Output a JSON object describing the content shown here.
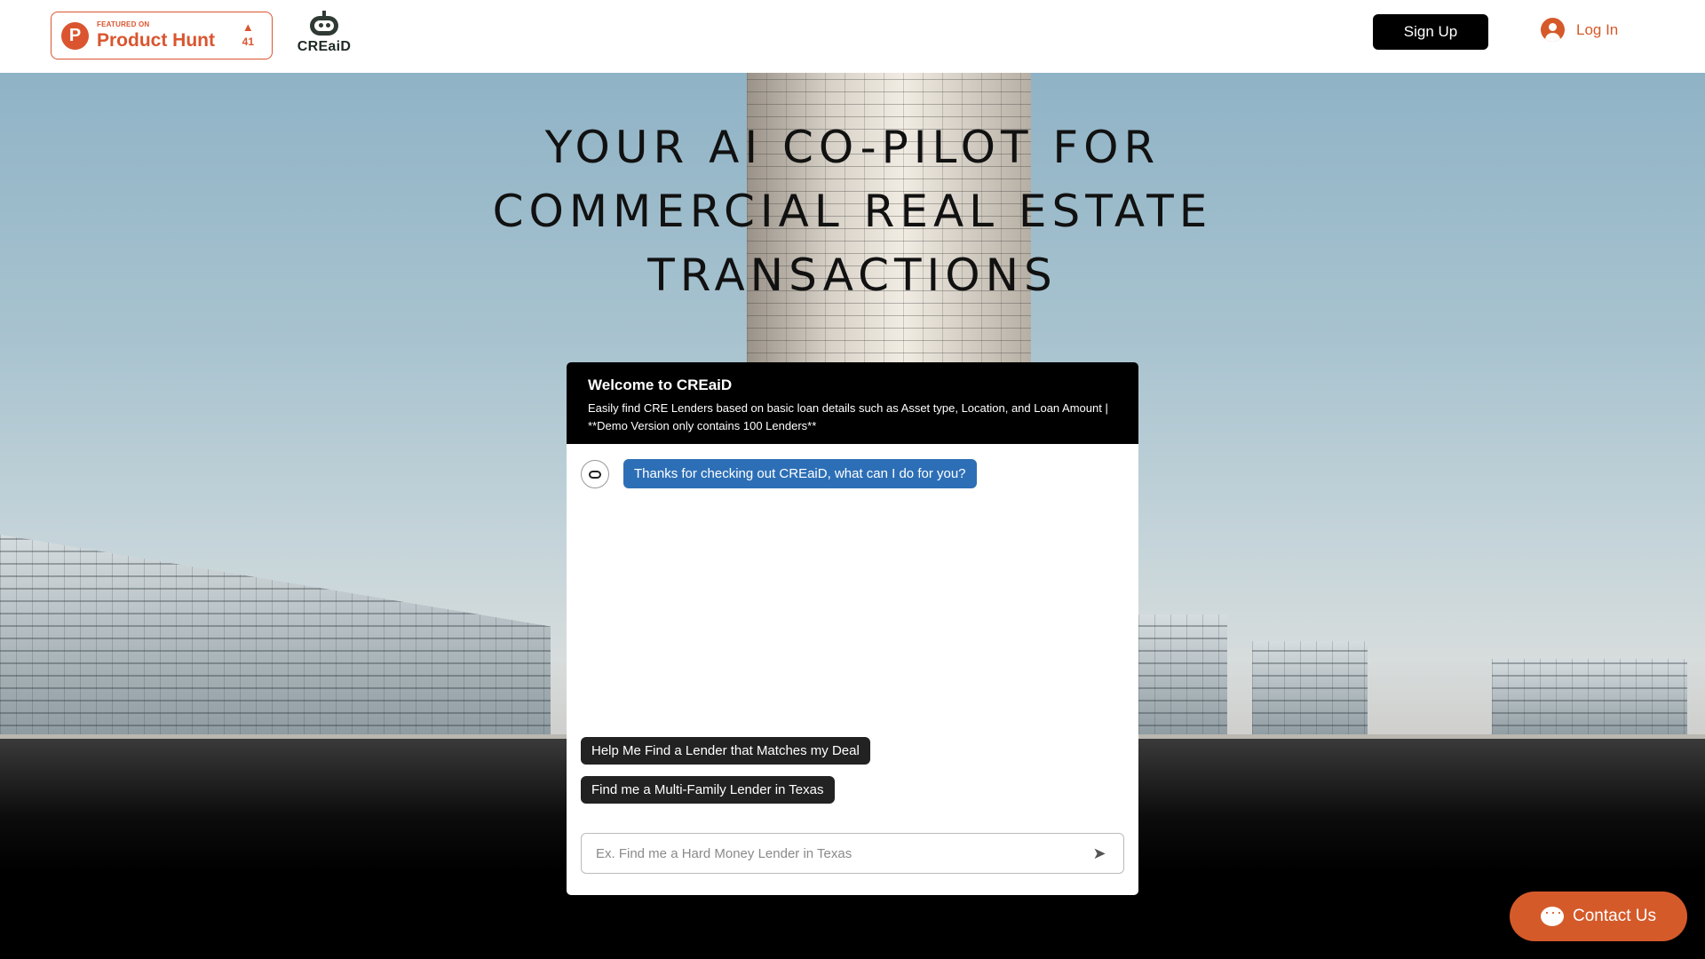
{
  "header": {
    "product_hunt": {
      "featured": "FEATURED ON",
      "name": "Product Hunt",
      "logo_letter": "P",
      "votes": "41"
    },
    "brand": {
      "name": "CREaiD"
    },
    "signup_label": "Sign Up",
    "login_label": "Log In"
  },
  "hero": {
    "headline": [
      "YOUR AI CO-PILOT FOR",
      "COMMERCIAL REAL ESTATE",
      "TRANSACTIONS"
    ]
  },
  "chat": {
    "title": "Welcome to CREaiD",
    "subtitle": "Easily find CRE Lenders based on basic loan details such as Asset type, Location, and Loan Amount | **Demo Version only contains 100 Lenders**",
    "bot_message": "Thanks for checking out CREaiD, what can I do for you?",
    "suggestions": [
      "Help Me Find a Lender that Matches my Deal",
      "Find me a Multi-Family Lender in Texas"
    ],
    "input_placeholder": "Ex. Find me a Hard Money Lender in Texas",
    "input_value": ""
  },
  "contact_label": "Contact Us",
  "colors": {
    "accent": "#d55a2a",
    "product_hunt": "#da552f",
    "bubble": "#2d6fb6"
  },
  "icons": {
    "login": "user-circle-icon",
    "send": "send-icon",
    "contact": "chat-bubble-icon",
    "bot": "bot-chat-icon",
    "upvote": "triangle-up-icon"
  }
}
